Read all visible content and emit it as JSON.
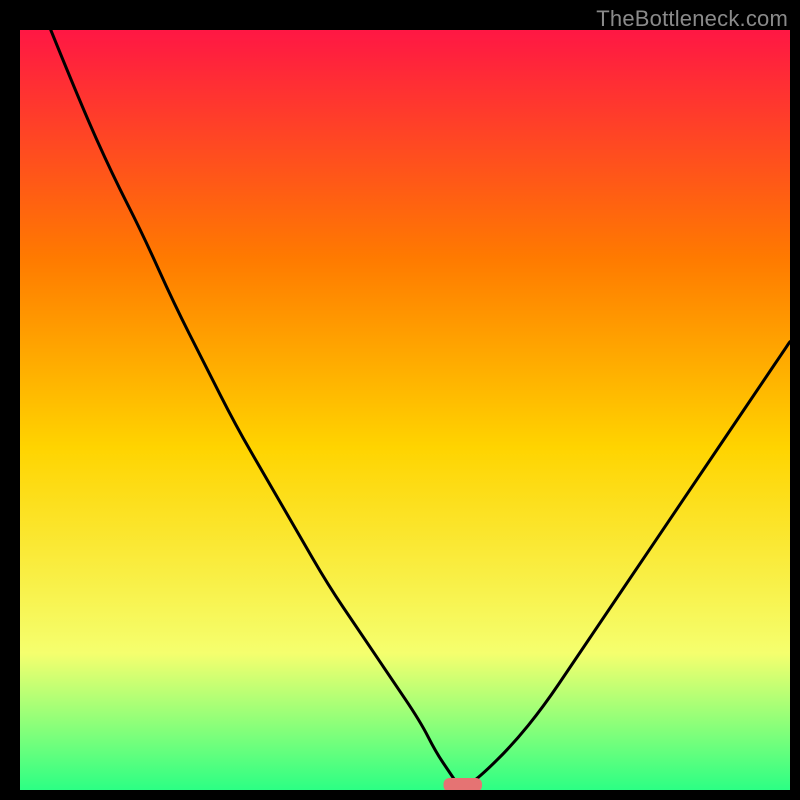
{
  "watermark": "TheBottleneck.com",
  "chart_data": {
    "type": "line",
    "title": "",
    "xlabel": "",
    "ylabel": "",
    "xlim": [
      0,
      100
    ],
    "ylim": [
      0,
      100
    ],
    "background_gradient": {
      "top": "#ff1744",
      "mid_upper": "#ff7a00",
      "mid": "#ffd400",
      "mid_lower": "#f5ff6e",
      "bottom": "#2cff84"
    },
    "series": [
      {
        "name": "bottleneck-curve",
        "x": [
          4,
          8,
          12,
          16,
          20,
          24,
          28,
          32,
          36,
          40,
          44,
          48,
          52,
          54,
          56,
          57,
          58,
          60,
          64,
          68,
          72,
          76,
          80,
          84,
          88,
          92,
          96,
          100
        ],
        "values": [
          100,
          90,
          81,
          73,
          64,
          56,
          48,
          41,
          34,
          27,
          21,
          15,
          9,
          5,
          2,
          0.5,
          0.5,
          2,
          6,
          11,
          17,
          23,
          29,
          35,
          41,
          47,
          53,
          59
        ]
      }
    ],
    "marker": {
      "name": "optimal-segment",
      "x_start": 55,
      "x_end": 60,
      "y": 0,
      "color": "#e57373"
    }
  }
}
